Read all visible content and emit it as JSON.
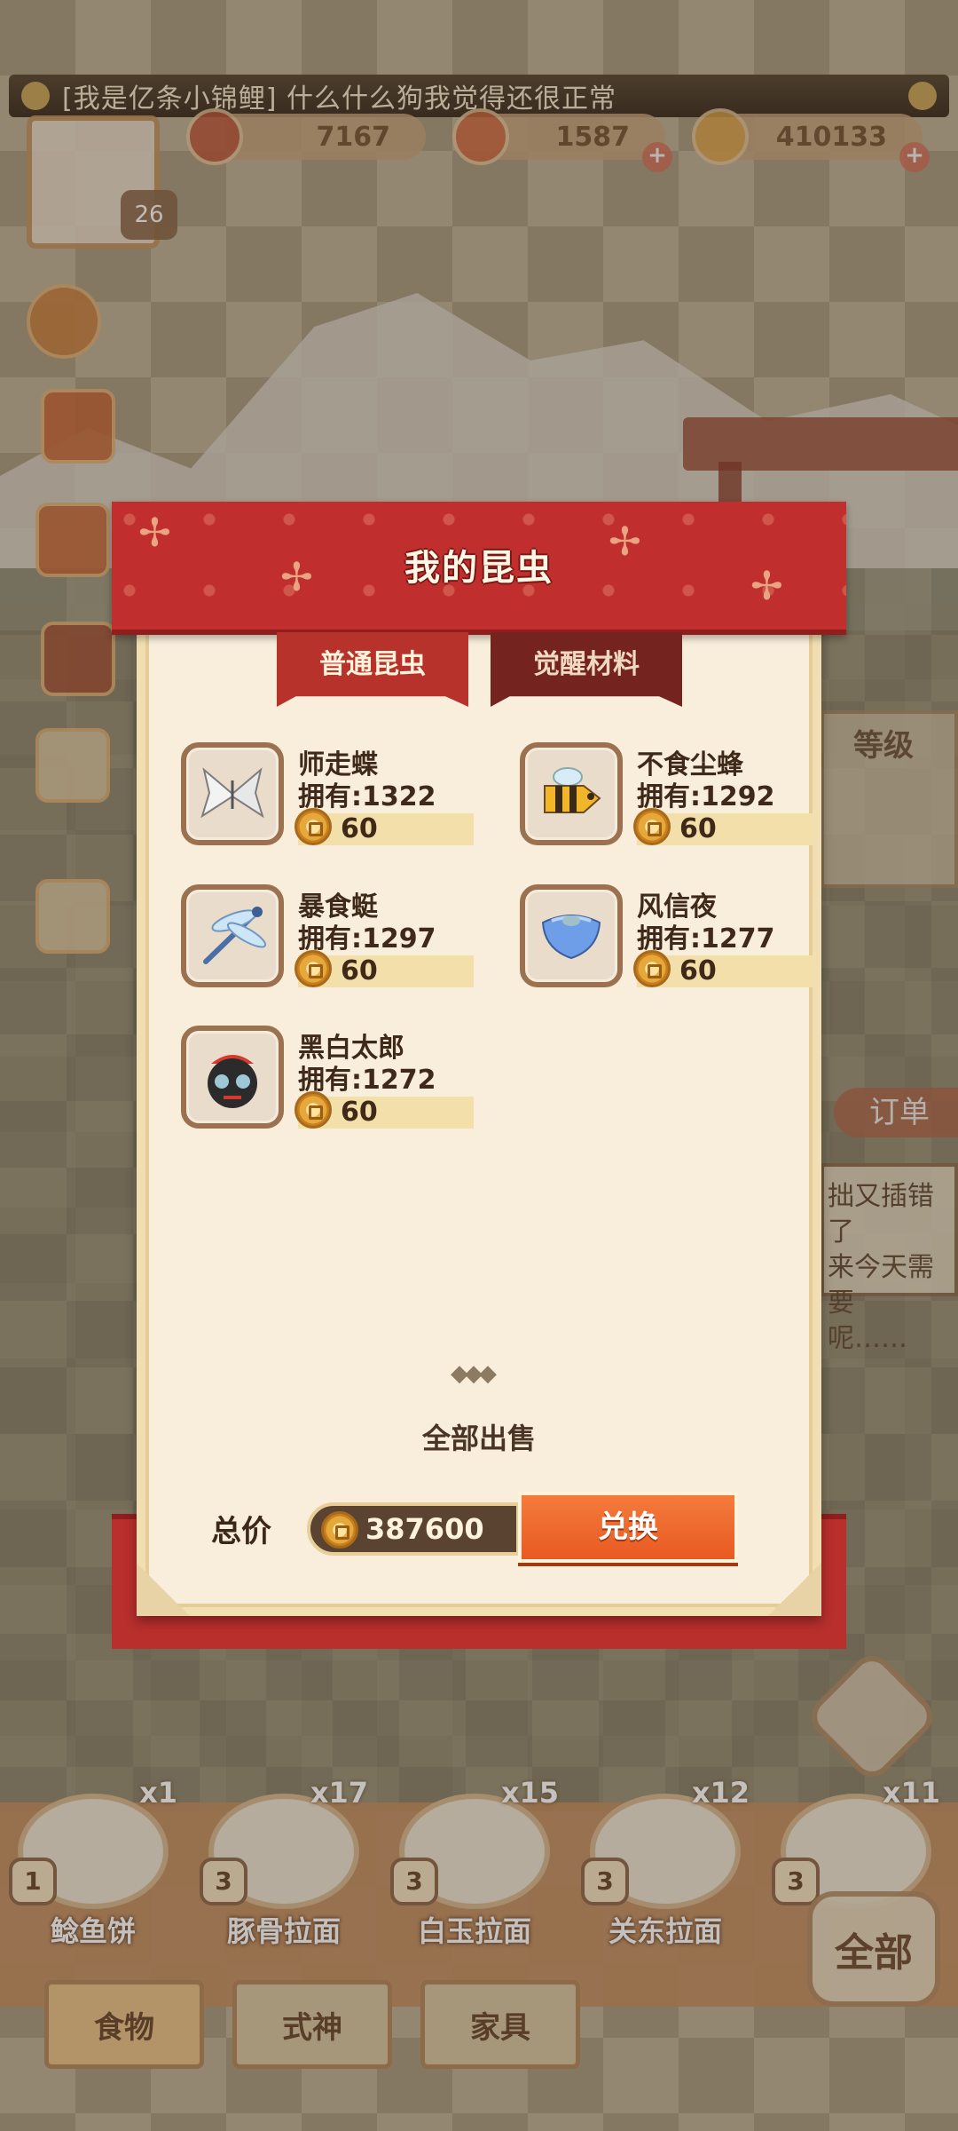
{
  "chat": {
    "text": "[我是亿条小锦鲤] 什么什么狗我觉得还很正常"
  },
  "resources": {
    "r1": "7167",
    "r2": "1587",
    "r3": "410133"
  },
  "level": "26",
  "side_labels": {
    "grade": "等级",
    "order": "订单"
  },
  "speech": {
    "l1": "拙又插错了",
    "l2": "来今天需要",
    "l3": "呢……"
  },
  "modal": {
    "title": "我的昆虫",
    "tabs": [
      "普通昆虫",
      "觉醒材料"
    ],
    "items": [
      {
        "name": "师走蝶",
        "owned": "拥有:1322",
        "price": "60",
        "icon": "butterfly-icon"
      },
      {
        "name": "不食尘蜂",
        "owned": "拥有:1292",
        "price": "60",
        "icon": "bee-icon"
      },
      {
        "name": "暴食蜓",
        "owned": "拥有:1297",
        "price": "60",
        "icon": "dragonfly-icon"
      },
      {
        "name": "风信夜",
        "owned": "拥有:1277",
        "price": "60",
        "icon": "moth-icon"
      },
      {
        "name": "黑白太郎",
        "owned": "拥有:1272",
        "price": "60",
        "icon": "ladybug-icon"
      }
    ],
    "sell_all": "全部出售",
    "total_label": "总价",
    "total_value": "387600",
    "exchange": "兑换"
  },
  "food": [
    {
      "name": "鲶鱼饼",
      "count": "x1",
      "level": "1"
    },
    {
      "name": "豚骨拉面",
      "count": "x17",
      "level": "3"
    },
    {
      "name": "白玉拉面",
      "count": "x15",
      "level": "3"
    },
    {
      "name": "关东拉面",
      "count": "x12",
      "level": "3"
    },
    {
      "name": "",
      "count": "x11",
      "level": "3"
    }
  ],
  "bottom_tabs": [
    "食物",
    "式神",
    "家具"
  ],
  "all_button": "全部",
  "colors": {
    "modal_red": "#c02f2d",
    "exchange_orange": "#f47b3b",
    "parchment": "#f9eedb"
  }
}
